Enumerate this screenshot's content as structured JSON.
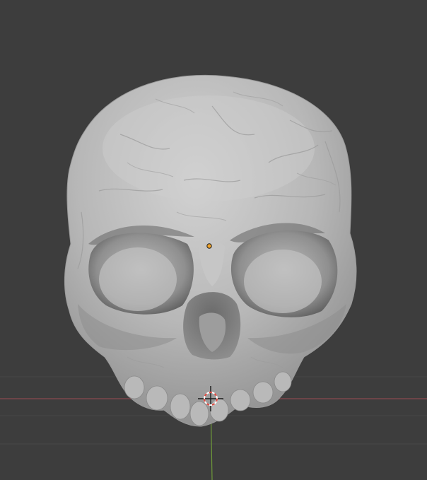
{
  "viewport": {
    "background_color": "#3d3d3d",
    "grid_color": "#474747",
    "x_axis_color": "#8a4a4f",
    "y_axis_color": "#6f9a3a",
    "model_color": "#b4b4b4",
    "origin_color": "#f0a32a",
    "cursor_color": "#e0463c"
  },
  "scene": {
    "object_icon": "sculpted-skull-mesh",
    "origin_icon": "object-origin-dot",
    "cursor_icon": "3d-cursor-icon"
  }
}
